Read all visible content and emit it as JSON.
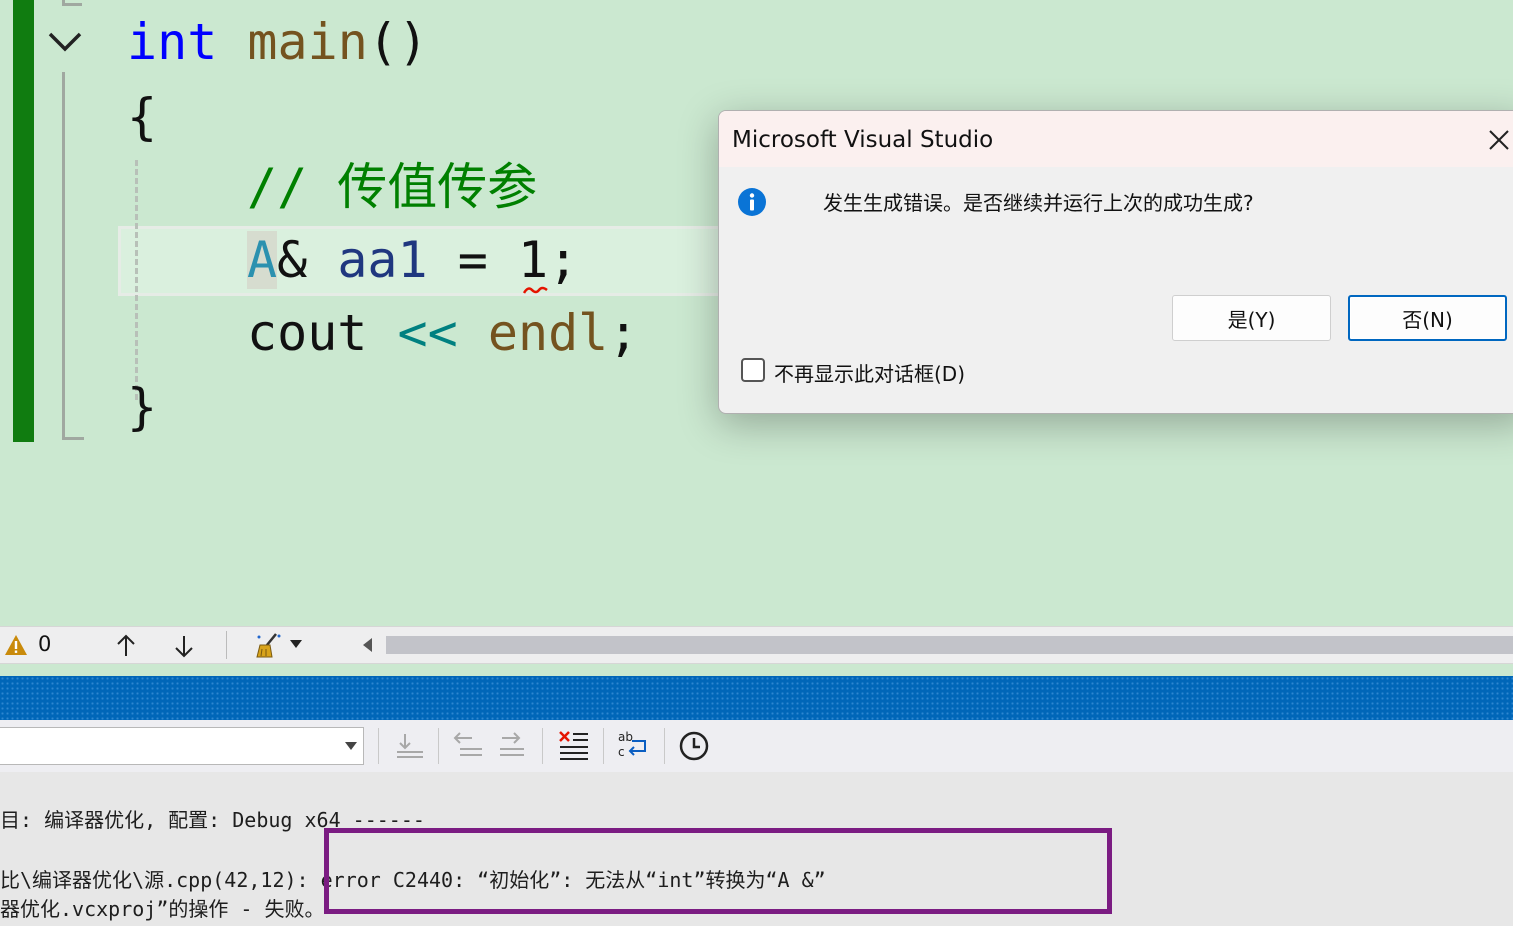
{
  "editor": {
    "lines": {
      "l1_kw": "int",
      "l1_fn": "main",
      "l1_paren": "()",
      "l2": "{",
      "l3_comment": "// 传值传参",
      "l4_type": "A",
      "l4_amp": "&",
      "l4_var": "aa1",
      "l4_eq": "=",
      "l4_num": "1",
      "l4_semi": ";",
      "l5_cout": "cout",
      "l5_op": "<<",
      "l5_endl": "endl",
      "l5_semi": ";",
      "l6": "}"
    }
  },
  "dialog": {
    "title": "Microsoft Visual Studio",
    "message": "发生生成错误。是否继续并运行上次的成功生成?",
    "yes_label": "是(Y)",
    "no_label": "否(N)",
    "checkbox_label": "不再显示此对话框(D)",
    "checkbox_checked": false,
    "icon": "info-icon"
  },
  "statusbar": {
    "warning_count": "0",
    "icons": [
      "warning-icon",
      "arrow-up-icon",
      "arrow-down-icon",
      "cleanup-brush-icon"
    ]
  },
  "output": {
    "lines": [
      "目: 编译器优化, 配置: Debug x64 ------",
      "比\\编译器优化\\源.cpp(42,12): error C2440: “初始化”: 无法从“int”转换为“A &”",
      "器优化.vcxproj”的操作 - 失败。"
    ]
  },
  "colors": {
    "editor_bg": "#cbe8d0",
    "gutter_changed": "#107c10",
    "panel_title": "#0066b8",
    "highlight_box": "#7b1c82"
  }
}
